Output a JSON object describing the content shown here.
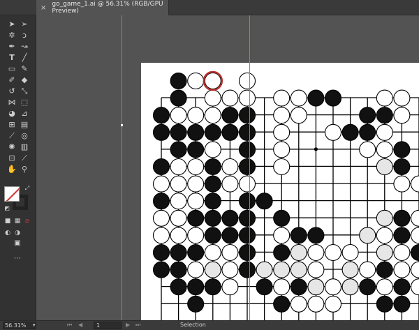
{
  "tab": {
    "title": "go_game_1.ai @ 56.31% (RGB/GPU Preview)",
    "close_glyph": "×"
  },
  "tools": [
    "selection-tool",
    "direct-selection-tool",
    "magic-wand-tool",
    "lasso-tool",
    "pen-tool",
    "curvature-tool",
    "type-tool",
    "line-tool",
    "rectangle-tool",
    "paintbrush-tool",
    "shaper-tool",
    "eraser-tool",
    "rotate-tool",
    "scale-tool",
    "width-tool",
    "free-transform-tool",
    "shape-builder-tool",
    "perspective-grid-tool",
    "mesh-tool",
    "gradient-tool",
    "eyedropper-tool",
    "blend-tool",
    "symbol-sprayer-tool",
    "column-graph-tool",
    "artboard-tool",
    "slice-tool",
    "hand-tool",
    "zoom-tool"
  ],
  "statusbar": {
    "zoom": "56.31%",
    "zoom_caret": "▾",
    "page": "1",
    "status": "Selection",
    "first_arrow": "⏮",
    "prev_arrow": "◀",
    "next_arrow": "▶",
    "last_arrow": "⏭"
  },
  "colors": {
    "selection_ring": "#b8322c",
    "guide": "#6f86b8"
  }
}
